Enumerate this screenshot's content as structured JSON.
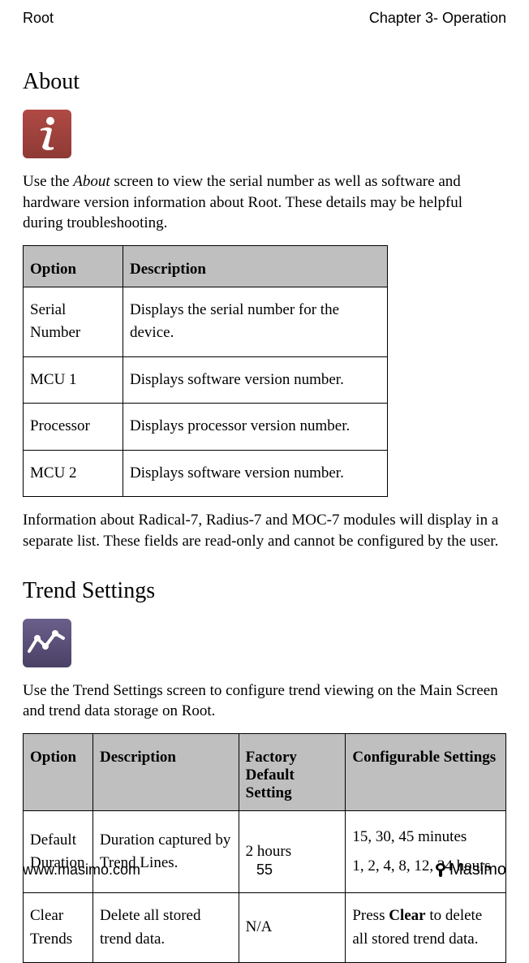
{
  "header": {
    "left": "Root",
    "right": "Chapter 3- Operation"
  },
  "section1": {
    "heading": "About",
    "intro": "Use the About screen to view the serial number as well as software and hardware version information about Root. These details may be helpful during troubleshooting.",
    "intro_italic_start": "About",
    "table_headers": {
      "c1": "Option",
      "c2": "Description"
    },
    "rows": [
      {
        "c1": "Serial Number",
        "c2": "Displays the serial number for the device."
      },
      {
        "c1": "MCU 1",
        "c2": "Displays software version number."
      },
      {
        "c1": "Processor",
        "c2": "Displays processor version number."
      },
      {
        "c1": "MCU 2",
        "c2": "Displays software version number."
      }
    ],
    "outro": "Information about Radical-7, Radius-7 and MOC-7 modules will display in a separate list. These fields are read-only and cannot be configured by the user."
  },
  "section2": {
    "heading": "Trend Settings",
    "intro": "Use the Trend Settings screen to configure trend viewing on the Main Screen and trend data storage on Root.",
    "table_headers": {
      "c1": "Option",
      "c2": "Description",
      "c3": "Factory Default Setting",
      "c4": "Configurable Settings"
    },
    "rows": [
      {
        "c1": "Default Duration",
        "c2": "Duration captured by Trend Lines.",
        "c3": "2 hours",
        "c4a": "15, 30, 45 minutes",
        "c4b": "1, 2, 4, 8, 12, 24 hours"
      },
      {
        "c1": "Clear Trends",
        "c2": "Delete all stored trend data.",
        "c3": "N/A",
        "c4_pre": "Press ",
        "c4_bold": "Clear",
        "c4_post": " to delete all stored trend data."
      }
    ]
  },
  "footer": {
    "left": "www.masimo.com",
    "center": "55",
    "right": "Masimo"
  }
}
